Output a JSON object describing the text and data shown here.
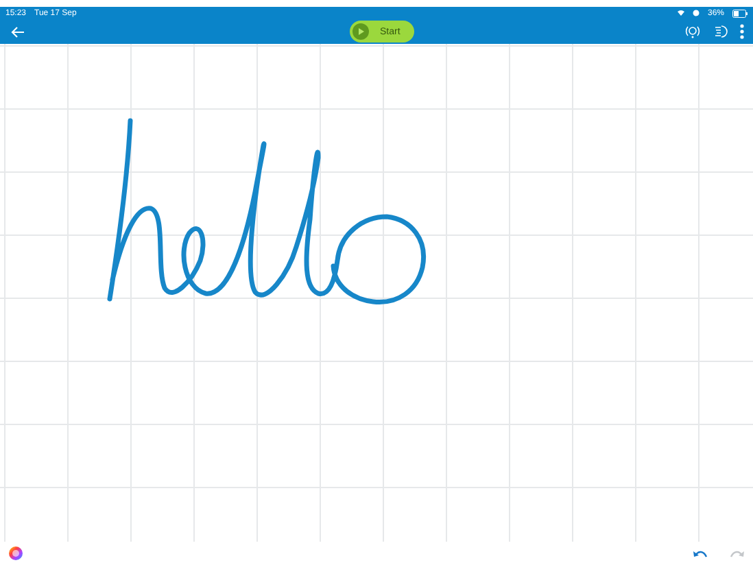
{
  "status_bar": {
    "time": "15:23",
    "date": "Tue 17 Sep",
    "battery": "36%"
  },
  "toolbar": {
    "start_button": "Start"
  },
  "bottom_bar": {
    "undo": {
      "disabled": false
    },
    "redo": {
      "disabled": true
    }
  }
}
